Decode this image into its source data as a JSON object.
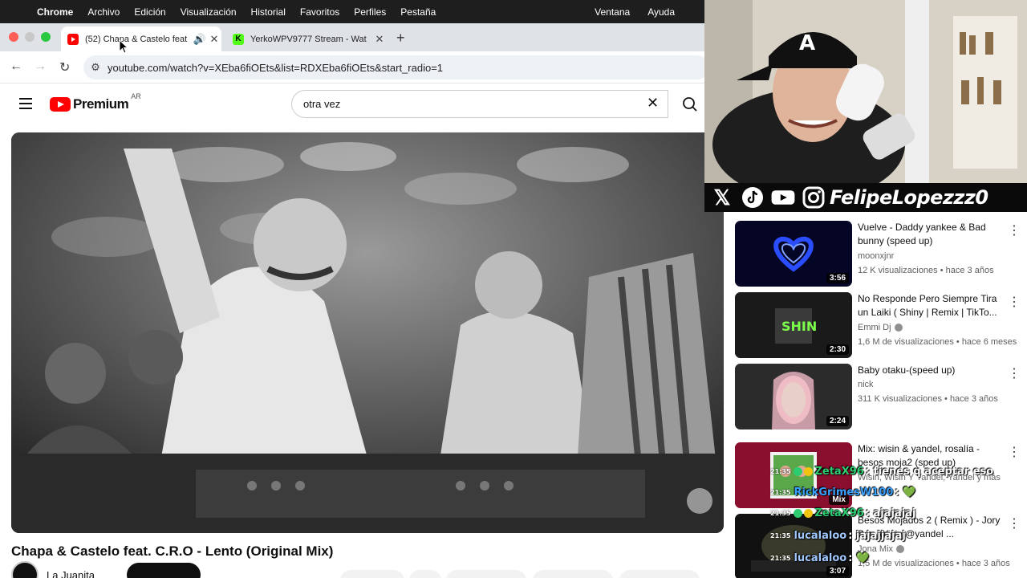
{
  "macos": {
    "app_name": "Chrome",
    "menu": [
      "Archivo",
      "Edición",
      "Visualización",
      "Historial",
      "Favoritos",
      "Perfiles",
      "Pestaña"
    ],
    "menu_right": [
      "Ventana",
      "Ayuda"
    ]
  },
  "browser": {
    "tabs": [
      {
        "title": "(52) Chapa & Castelo feat",
        "favicon": "youtube-icon"
      },
      {
        "title": "YerkoWPV9777 Stream - Wat",
        "favicon": "kick-icon"
      }
    ],
    "url": "youtube.com/watch?v=XEba6fiOEts&list=RDXEba6fiOEts&start_radio=1"
  },
  "youtube": {
    "logo": "Premium",
    "country": "AR",
    "search_value": "otra vez",
    "video_title": "Chapa & Castelo feat. C.R.O - Lento (Original Mix)",
    "channel_name": "La Juanita"
  },
  "stream": {
    "handle": "FelipeLopezzz0",
    "socials": [
      "x-icon",
      "tiktok-icon",
      "youtube-icon",
      "instagram-icon"
    ]
  },
  "recommendations": [
    {
      "title": "Vuelve - Daddy yankee & Bad bunny (speed up)",
      "channel": "moonxjnr",
      "views": "12 K visualizaciones",
      "age": "hace 3 años",
      "duration": "3:56",
      "thumb_color": "#050526"
    },
    {
      "title": "No Responde Pero Siempre Tira un Laiki ( Shiny | Remix | TikTo...",
      "channel": "Emmi Dj",
      "views": "1,6 M de visualizaciones",
      "age": "hace 6 meses",
      "duration": "2:30",
      "thumb_color": "#1a1a1a"
    },
    {
      "title": "Baby otaku-(speed up)",
      "channel": "nick",
      "views": "311 K visualizaciones",
      "age": "hace 3 años",
      "duration": "2:24",
      "thumb_color": "#2a2a2a"
    },
    {
      "title": "Mix: wisin & yandel, rosalía - besos moja2 (sped up)",
      "channel": "Wisin, Wisin Y Yandel, Yandel y más",
      "views": "",
      "age": "",
      "duration": "Mix",
      "thumb_color": "#8a0f2e"
    },
    {
      "title": "Besos Mojados 2 ( Remix ) - Jory Boy, Wisin @yandel ...",
      "channel": "Jona Mix",
      "views": "1,5 M de visualizaciones",
      "age": "hace 3 años",
      "duration": "3:07",
      "thumb_color": "#111111"
    }
  ],
  "chat": [
    {
      "time": "21:35",
      "user": "ZetaX96",
      "message": ": tienes q aceptar eso",
      "color": "#2ecc71"
    },
    {
      "time": "21:35",
      "user": "RickGrimesW100",
      "message": ": 💚",
      "color": "#3aa0ff"
    },
    {
      "time": "21:35",
      "user": "ZetaX96",
      "message": ": ajajajaj",
      "color": "#2ecc71"
    },
    {
      "time": "21:35",
      "user": "lucalaloo",
      "message": ": jajajjajaj",
      "color": "#a0c8ff"
    },
    {
      "time": "21:35",
      "user": "lucalaloo",
      "message": ": 💚",
      "color": "#a0c8ff"
    }
  ]
}
